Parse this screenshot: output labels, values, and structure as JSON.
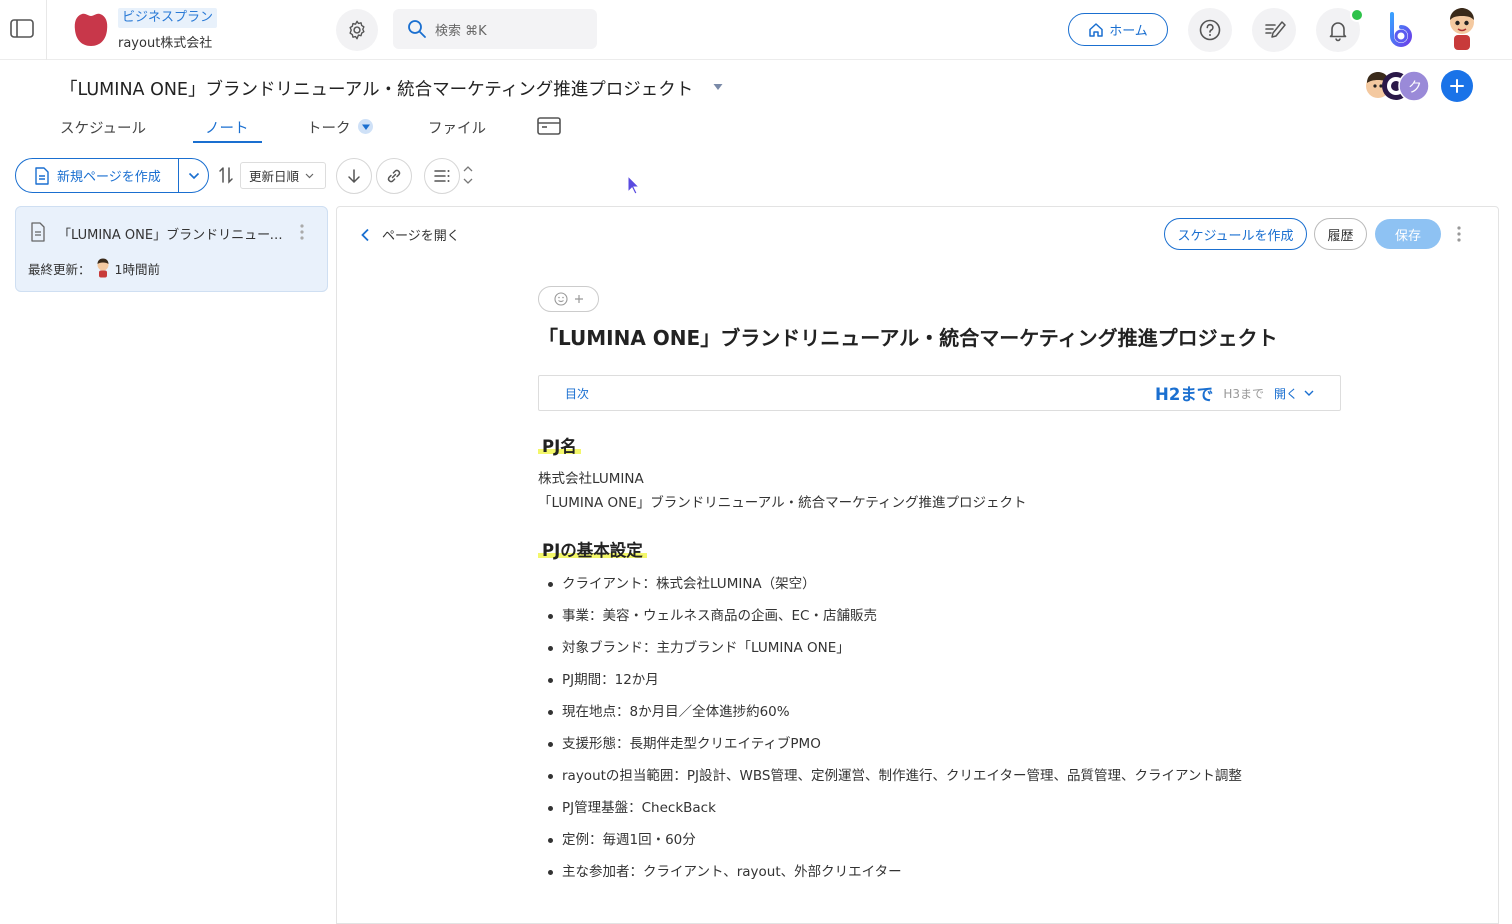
{
  "header": {
    "plan_badge": "ビジネスプラン",
    "company": "rayout株式会社",
    "search_placeholder": "検索 ⌘K",
    "home_label": "ホーム"
  },
  "project": {
    "title": "「LUMINA ONE」ブランドリニューアル・統合マーケティング推進プロジェクト",
    "member_initial": "ク",
    "tabs": [
      {
        "label": "スケジュール"
      },
      {
        "label": "ノート"
      },
      {
        "label": "トーク"
      },
      {
        "label": "ファイル"
      }
    ]
  },
  "toolbar": {
    "new_page_label": "新規ページを作成",
    "sort_label": "更新日順"
  },
  "page_list": [
    {
      "title": "「LUMINA ONE」ブランドリニューアル・統合マーケティング推進プロジェクト",
      "updated_label": "最終更新：",
      "updated_time": "1時間前"
    }
  ],
  "panel": {
    "open_page_label": "ページを開く",
    "schedule_button": "スケジュールを作成",
    "history_button": "履歴",
    "save_button": "保存"
  },
  "document": {
    "title": "「LUMINA ONE」ブランドリニューアル・統合マーケティング推進プロジェクト",
    "toc": {
      "label": "目次",
      "h2_option": "H2まで",
      "h3_option": "H3まで",
      "open_label": "開く"
    },
    "sections": [
      {
        "heading": "PJ名",
        "lines": [
          "株式会社LUMINA",
          "「LUMINA ONE」ブランドリニューアル・統合マーケティング推進プロジェクト"
        ]
      },
      {
        "heading": "PJの基本設定",
        "bullets": [
          "クライアント：株式会社LUMINA（架空）",
          "事業：美容・ウェルネス商品の企画、EC・店舗販売",
          "対象ブランド：主力ブランド「LUMINA ONE」",
          "PJ期間：12か月",
          "現在地点：8か月目／全体進捗約60%",
          "支援形態：長期伴走型クリエイティブPMO",
          "rayoutの担当範囲：PJ設計、WBS管理、定例運営、制作進行、クリエイター管理、品質管理、クライアント調整",
          "PJ管理基盤：CheckBack",
          "定例：毎週1回・60分",
          "主な参加者：クライアント、rayout、外部クリエイター"
        ]
      }
    ]
  },
  "colors": {
    "accent": "#1a6fd0",
    "highlight": "#f3f76a",
    "logo": "#c8374a",
    "notification": "#2ec24a"
  }
}
